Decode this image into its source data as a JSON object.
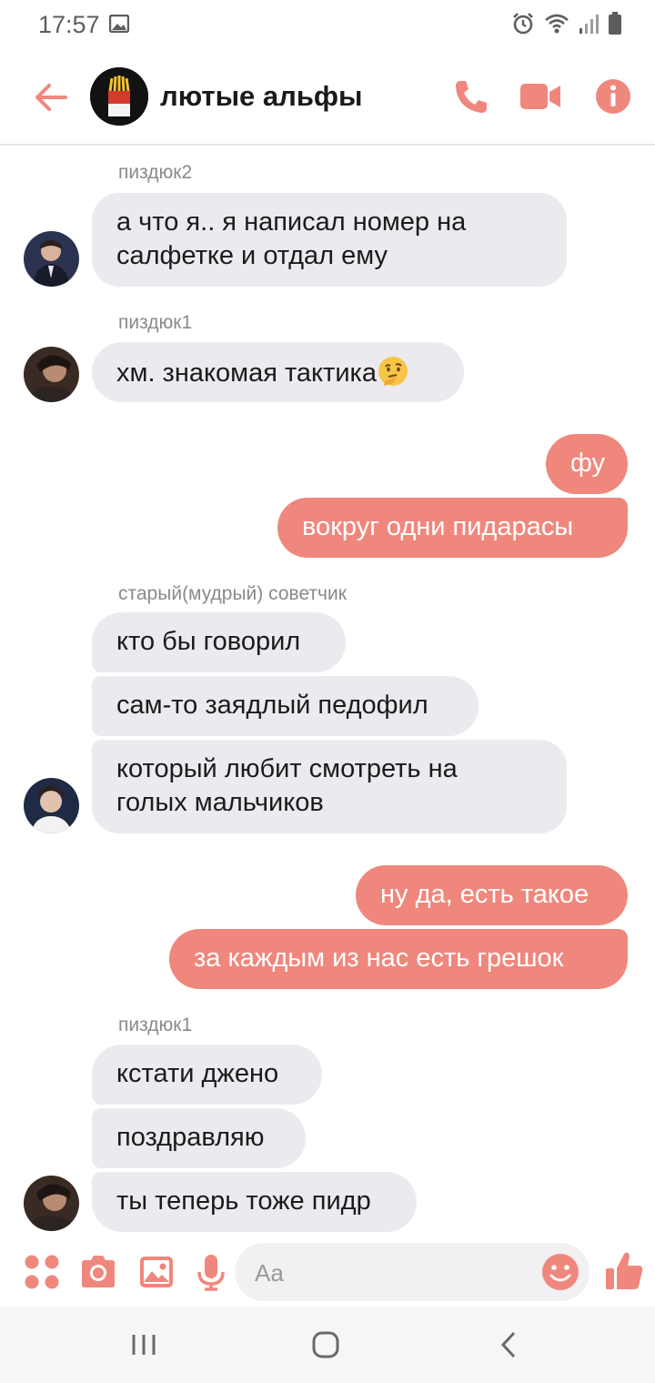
{
  "status_bar": {
    "time": "17:57",
    "icons": [
      "gallery-icon",
      "alarm-icon",
      "wifi-icon",
      "signal-icon",
      "battery-icon"
    ]
  },
  "header": {
    "title": "лютые альфы",
    "back_icon": "arrow-left-icon",
    "actions": [
      "phone-icon",
      "video-camera-icon",
      "info-icon"
    ],
    "accent_color": "#f0877d"
  },
  "messages": [
    {
      "sender": "пиздюк2",
      "lines": [
        "а что я.. я написал номер на",
        "салфетке и отдал ему"
      ]
    },
    {
      "sender": "пиздюк1",
      "text": "хм. знакомая тактика",
      "emoji": "thinking-face-emoji"
    },
    {
      "out_1": "фу",
      "out_2": "вокруг одни пидарасы"
    },
    {
      "sender": "старый(мудрый) советчик",
      "m1": "кто бы говорил",
      "m2": "сам-то заядлый педофил",
      "m3_lines": [
        "который любит смотреть на",
        "голых мальчиков"
      ]
    },
    {
      "out_1": "ну да, есть такое",
      "out_2": "за каждым из нас есть грешок"
    },
    {
      "sender": "пиздюк1",
      "m1": "кстати джено",
      "m2": "поздравляю",
      "m3": "ты теперь тоже пидр"
    }
  ],
  "composer": {
    "placeholder": "Aa",
    "icons": [
      "apps-icon",
      "camera-icon",
      "image-icon",
      "microphone-icon",
      "smiley-icon",
      "thumbs-up-icon"
    ]
  },
  "colors": {
    "incoming_bubble": "#ebeaee",
    "outgoing_bubble": "#f0877d",
    "accent": "#f0877d"
  }
}
